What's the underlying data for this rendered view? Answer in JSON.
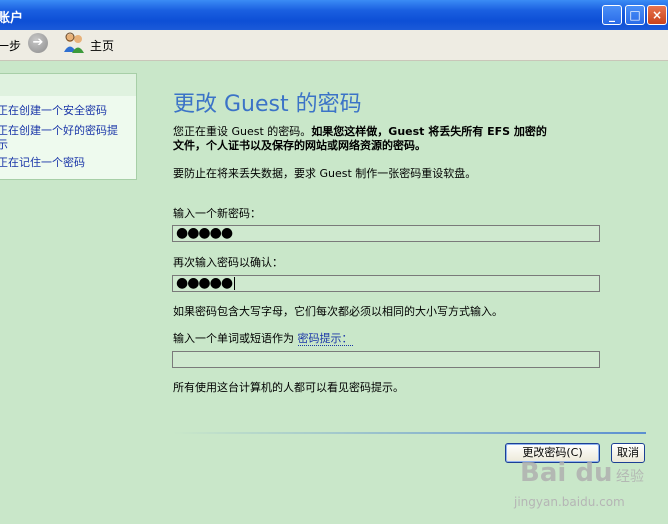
{
  "window": {
    "title": "账户",
    "buttons": {
      "minimize": "_",
      "maximize": "□",
      "close": "×"
    }
  },
  "toolbar": {
    "back_label": "一步",
    "home_label": "主页"
  },
  "sidebar": {
    "links": [
      "正在创建一个安全密码",
      "正在创建一个好的密码提",
      "示",
      "正在记住一个密码"
    ]
  },
  "main": {
    "title": "更改 Guest 的密码",
    "intro_normal": "您正在重设 Guest 的密码。",
    "intro_bold_1": "如果您这样做，Guest 将丢失所有 EFS 加密的",
    "intro_bold_2": "文件，个人证书以及保存的网站或网络资源的密码。",
    "disk_note": "要防止在将来丢失数据，要求 Guest 制作一张密码重设软盘。",
    "new_password_label": "输入一个新密码：",
    "new_password_value": "●●●●●",
    "confirm_label": "再次输入密码以确认：",
    "confirm_value": "●●●●●",
    "case_note": "如果密码包含大写字母，它们每次都必须以相同的大小写方式输入。",
    "hint_label_prefix": "输入一个单词或短语作为",
    "hint_link": "密码提示：",
    "hint_value": "",
    "hint_note": "所有使用这台计算机的人都可以看见密码提示。",
    "change_button": "更改密码(C)",
    "cancel_button": "取消"
  },
  "watermark": {
    "logo": "Bai du",
    "text": "经验",
    "url": "jingyan.baidu.com"
  }
}
